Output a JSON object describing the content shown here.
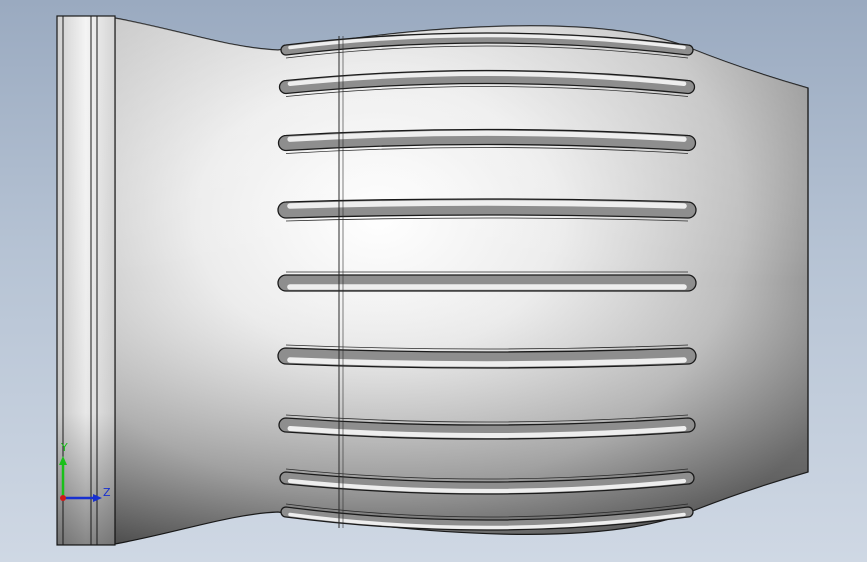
{
  "viewport": {
    "background_top": "#9aaac0",
    "background_bottom": "#cfd8e4"
  },
  "part": {
    "body_color": "#d9d9d9",
    "highlight_color": "#ffffff",
    "shadow_color": "#7a7a7a",
    "edge_color": "#1a1a1a",
    "slot_count": 9
  },
  "triad": {
    "y_label": "Y",
    "z_label": "Z",
    "y_color": "#19c019",
    "z_color": "#1830d0",
    "x_color": "#d01818"
  }
}
